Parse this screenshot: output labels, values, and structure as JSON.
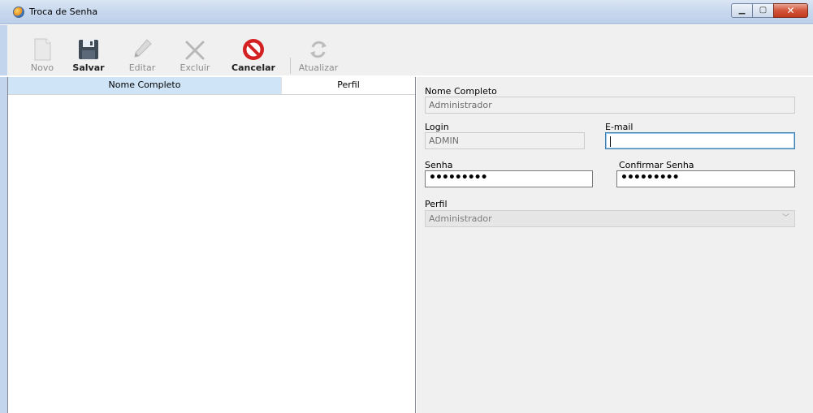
{
  "window": {
    "title": "Troca de Senha"
  },
  "toolbar": {
    "novo": "Novo",
    "salvar": "Salvar",
    "editar": "Editar",
    "excluir": "Excluir",
    "cancelar": "Cancelar",
    "atualizar": "Atualizar"
  },
  "list": {
    "columns": [
      "Nome Completo",
      "Perfil"
    ]
  },
  "form": {
    "nome_label": "Nome Completo",
    "nome_value": "Administrador",
    "login_label": "Login",
    "login_value": "ADMIN",
    "email_label": "E-mail",
    "email_value": "",
    "senha_label": "Senha",
    "senha_value": "•••••••••",
    "confirmar_label": "Confirmar Senha",
    "confirmar_value": "•••••••••",
    "perfil_label": "Perfil",
    "perfil_value": "Administrador"
  },
  "colors": {
    "titlebar": "#c9d9ee",
    "selected_header": "#cfe4f7",
    "close_button": "#c9452b"
  },
  "icons": [
    "app-icon",
    "new-doc-icon",
    "floppy-disk-icon",
    "pencil-icon",
    "x-delete-icon",
    "cancel-no-entry-icon",
    "refresh-icon"
  ]
}
